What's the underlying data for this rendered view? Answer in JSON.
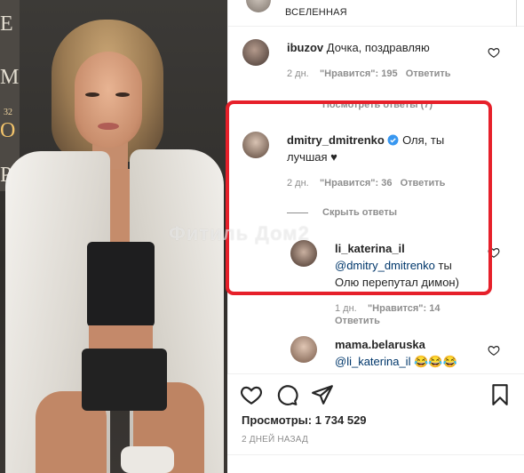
{
  "photo": {
    "board_letters": [
      "E",
      "M",
      "O",
      "P"
    ],
    "board_number": "32"
  },
  "header": {
    "account_text": "ВСЕЛЕННАЯ"
  },
  "comments": [
    {
      "username": "ibuzov",
      "text": "Дочка, поздравляю",
      "age": "2 дн.",
      "likes": "\"Нравится\": 195",
      "reply": "Ответить",
      "replies_link": "Посмотреть ответы (7)"
    },
    {
      "username": "dmitry_dmitrenko",
      "verified": true,
      "text_line1": "Оля, ты",
      "text_line2": "лучшая ♥",
      "age": "2 дн.",
      "likes": "\"Нравится\": 36",
      "reply": "Ответить",
      "hide_replies": "Скрыть ответы"
    },
    {
      "username": "li_katerina_il",
      "mention": "@dmitry_dmitrenko",
      "text_after": "ты",
      "text_line2": "Олю перепутал димон)",
      "age": "1 дн.",
      "likes": "\"Нравится\": 14",
      "reply": "Ответить"
    },
    {
      "username": "mama.belaruska",
      "mention": "@li_katerina_il",
      "text_after": "😂😂😂"
    }
  ],
  "watermark": "Фитиль Дом2",
  "actions": {
    "views_label": "Просмотры: 1 734 529",
    "date_label": "2 ДНЕЙ НАЗАД"
  },
  "colors": {
    "highlight": "#e6202a",
    "verified": "#3897f0",
    "mention": "#00376b"
  },
  "icons": [
    "heart-icon",
    "comment-icon",
    "share-icon",
    "bookmark-icon",
    "verified-badge-icon"
  ]
}
